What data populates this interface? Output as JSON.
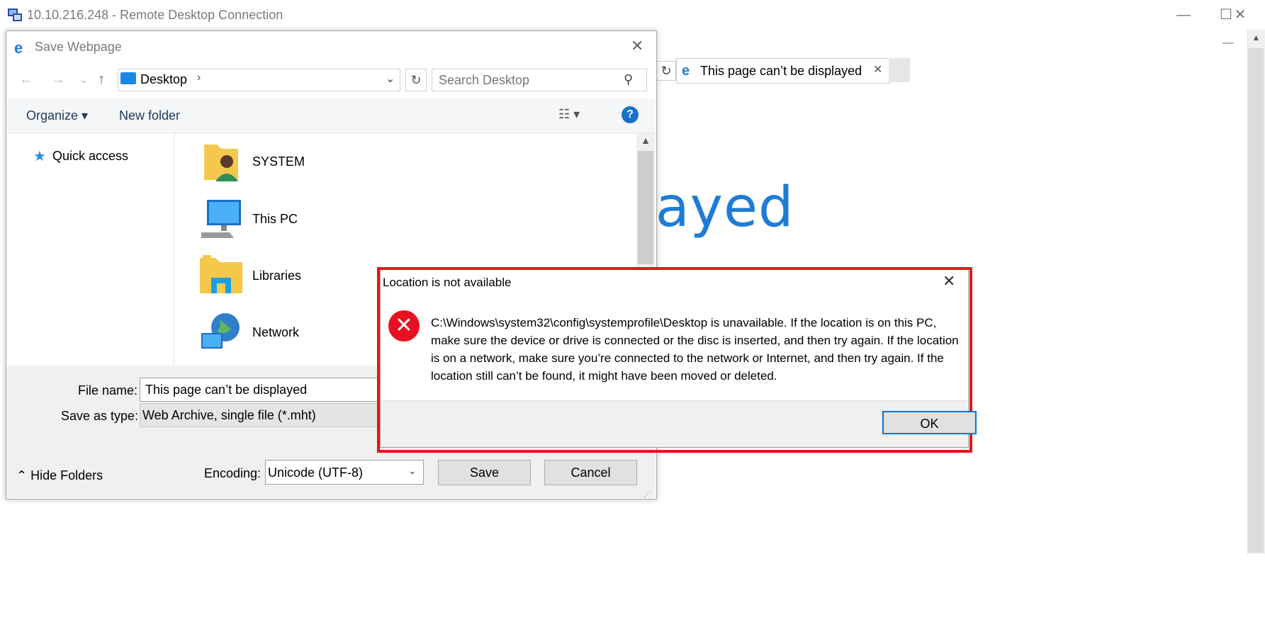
{
  "rdp": {
    "title": "10.10.216.248 - Remote Desktop Connection",
    "minimize": "—",
    "maximize": "☐",
    "close": "✕"
  },
  "ie": {
    "tab_title": "This page can’t be displayed",
    "big_heading_fragment": "ayed",
    "refresh_icon": "↻",
    "tab_close": "✕",
    "tab_icon": "e"
  },
  "save_dialog": {
    "title": "Save Webpage",
    "title_icon": "e",
    "close": "✕",
    "nav": {
      "back": "←",
      "forward": "→",
      "recent": "⌄",
      "up": "↑"
    },
    "address": {
      "location": "Desktop",
      "chevron": "›",
      "dropdown": "⌄",
      "refresh": "↻"
    },
    "search": {
      "placeholder": "Search Desktop",
      "icon": "⚲"
    },
    "toolbar": {
      "organize": "Organize ▾",
      "new_folder": "New folder",
      "view_icon": "☷ ▾",
      "help": "?"
    },
    "nav_pane": {
      "quick_access": "Quick access",
      "star_icon": "★"
    },
    "files": [
      {
        "label": "SYSTEM",
        "icon": "user-folder-icon"
      },
      {
        "label": "This PC",
        "icon": "computer-icon"
      },
      {
        "label": "Libraries",
        "icon": "libraries-folder-icon"
      },
      {
        "label": "Network",
        "icon": "network-icon"
      }
    ],
    "scroll_up": "▲",
    "file_name_label": "File name:",
    "file_name_value": "This page can’t be displayed",
    "save_as_type_label": "Save as type:",
    "save_as_type_value": "Web Archive, single file (*.mht)",
    "hide_folders": "⌃ Hide Folders",
    "encoding_label": "Encoding:",
    "encoding_value": "Unicode (UTF-8)",
    "encoding_drop": "⌄",
    "save_button": "Save",
    "cancel_button": "Cancel",
    "grip": "⋰"
  },
  "error_dialog": {
    "title": "Location is not available",
    "close": "✕",
    "icon": "✕",
    "message": "C:\\Windows\\system32\\config\\systemprofile\\Desktop is unavailable. If the location is on this PC, make sure the device or drive is connected or the disc is inserted, and then try again. If the location is on a network, make sure you’re connected to the network or Internet, and then try again. If the location still can’t be found, it might have been moved or deleted.",
    "ok_button": "OK",
    "highlight_color": "#e8151b"
  },
  "colors": {
    "accent": "#1e7cd6",
    "error_red": "#e81123",
    "focus_blue": "#0078d7"
  }
}
